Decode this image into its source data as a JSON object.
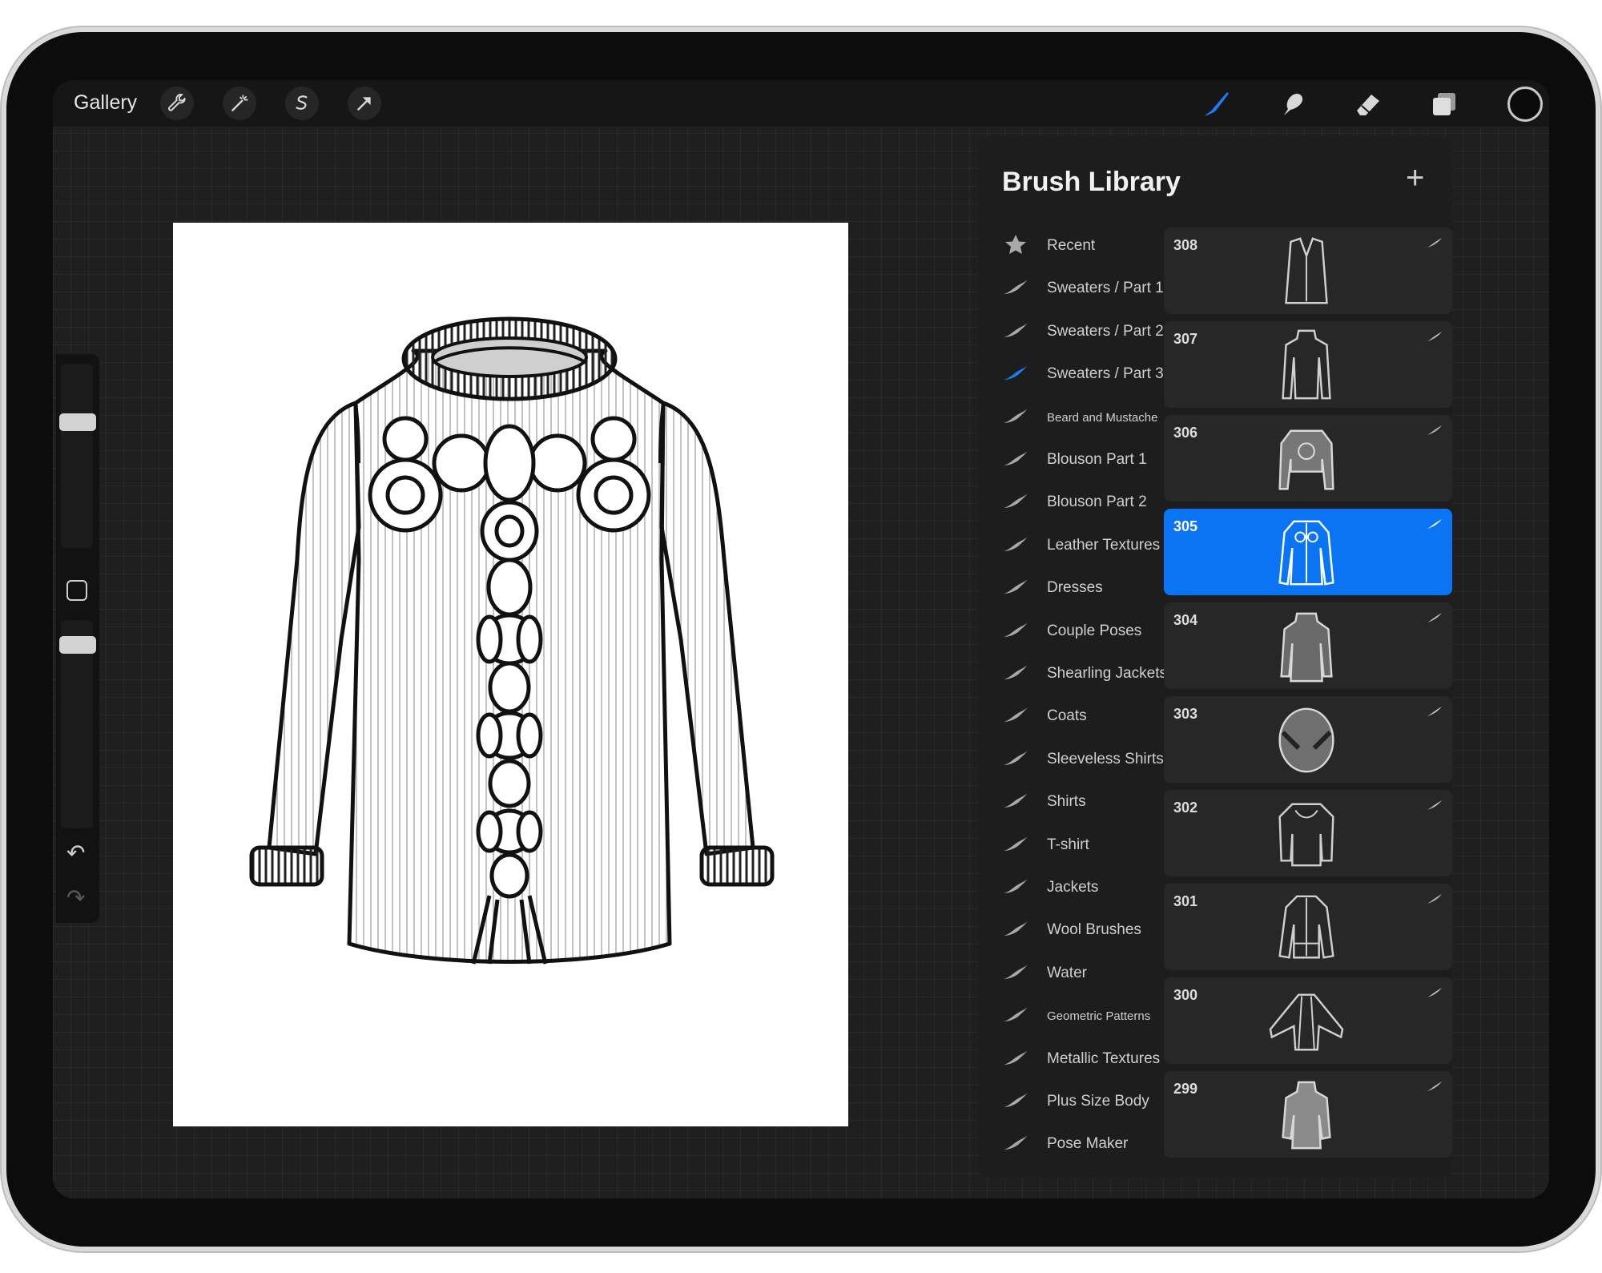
{
  "topbar": {
    "gallery_label": "Gallery",
    "left_tools": [
      "wrench-icon",
      "magic-wand-icon",
      "selection-icon",
      "transform-arrow-icon"
    ],
    "right_tools": [
      "brush-icon",
      "smudge-icon",
      "eraser-icon",
      "layers-icon"
    ],
    "active_tool": "brush-icon",
    "active_tool_color": "#1a7cf5",
    "current_color": "#0b0b0b"
  },
  "sidebar": {
    "tools": [
      "brush-size-slider",
      "modifier-button",
      "opacity-slider",
      "undo-icon",
      "redo-icon"
    ]
  },
  "brush_library": {
    "title": "Brush Library",
    "add_label": "+",
    "sets": [
      {
        "label": "Recent",
        "icon": "star-icon"
      },
      {
        "label": "Sweaters / Part 1",
        "icon": "brush-stroke-icon"
      },
      {
        "label": "Sweaters / Part 2",
        "icon": "brush-stroke-icon"
      },
      {
        "label": "Sweaters / Part 3",
        "icon": "brush-stroke-icon",
        "selected": true
      },
      {
        "label": "Beard and Mustache",
        "icon": "brush-stroke-icon"
      },
      {
        "label": "Blouson Part 1",
        "icon": "brush-stroke-icon"
      },
      {
        "label": "Blouson Part 2",
        "icon": "brush-stroke-icon"
      },
      {
        "label": "Leather Textures",
        "icon": "brush-stroke-icon"
      },
      {
        "label": "Dresses",
        "icon": "brush-stroke-icon"
      },
      {
        "label": "Couple Poses",
        "icon": "brush-stroke-icon"
      },
      {
        "label": "Shearling Jackets",
        "icon": "brush-stroke-icon"
      },
      {
        "label": "Coats",
        "icon": "brush-stroke-icon"
      },
      {
        "label": "Sleeveless Shirts",
        "icon": "brush-stroke-icon"
      },
      {
        "label": "Shirts",
        "icon": "brush-stroke-icon"
      },
      {
        "label": "T-shirt",
        "icon": "brush-stroke-icon"
      },
      {
        "label": "Jackets",
        "icon": "brush-stroke-icon"
      },
      {
        "label": "Wool Brushes",
        "icon": "brush-stroke-icon"
      },
      {
        "label": "Water",
        "icon": "brush-stroke-icon"
      },
      {
        "label": "Geometric Patterns",
        "icon": "brush-stroke-icon"
      },
      {
        "label": "Metallic Textures",
        "icon": "brush-stroke-icon"
      },
      {
        "label": "Plus Size Body",
        "icon": "brush-stroke-icon"
      },
      {
        "label": "Pose Maker",
        "icon": "brush-stroke-icon"
      }
    ],
    "brushes": [
      {
        "number": "308",
        "thumbnail": "vest-sweater"
      },
      {
        "number": "307",
        "thumbnail": "turtleneck-sweater"
      },
      {
        "number": "306",
        "thumbnail": "cropped-knit-sweater"
      },
      {
        "number": "305",
        "thumbnail": "embroidered-cardigan",
        "selected": true
      },
      {
        "number": "304",
        "thumbnail": "patterned-knit-top"
      },
      {
        "number": "303",
        "thumbnail": "round-knit-sweater"
      },
      {
        "number": "302",
        "thumbnail": "lace-sleeve-top"
      },
      {
        "number": "301",
        "thumbnail": "zip-track-jacket"
      },
      {
        "number": "300",
        "thumbnail": "batwing-jacket"
      },
      {
        "number": "299",
        "thumbnail": "floral-knit-top"
      }
    ],
    "selected_color": "#0a74f5"
  },
  "canvas": {
    "artwork": "line drawing of a ribbed sweater with ornamental front embroidery"
  }
}
